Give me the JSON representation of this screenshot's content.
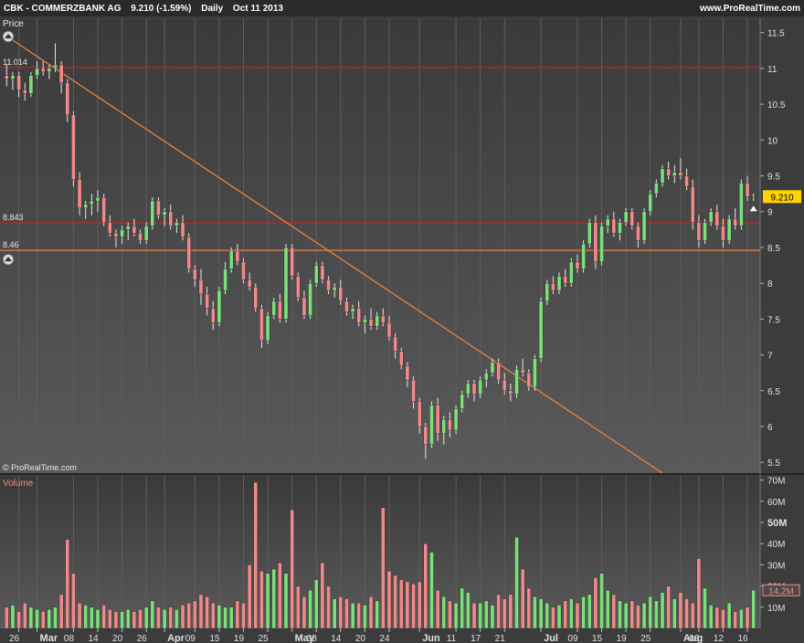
{
  "header": {
    "symbol": "CBK - COMMERZBANK AG",
    "quote": "9.210 (-1.59%)",
    "period": "Daily",
    "date": "Oct 11 2013",
    "site": "www.ProRealTime.com"
  },
  "panels": {
    "price_label": "Price",
    "volume_label": "Volume",
    "copyright": "© ProRealTime.com",
    "last_price_tag": "9.210",
    "last_volume_tag": "14.2M"
  },
  "colors": {
    "up": "#7be07b",
    "down": "#f08a8a",
    "resistance": "#cc2222",
    "support": "#e8804a",
    "trendline": "#e8804a",
    "price_tag": "#ffd400"
  },
  "chart_data": [
    {
      "type": "candlestick",
      "title": "CBK - COMMERZBANK AG",
      "ylabel": "Price",
      "ylim": [
        5.35,
        11.7
      ],
      "y_ticks": [
        5.5,
        6,
        6.5,
        7,
        7.5,
        8,
        8.5,
        9,
        9.5,
        10,
        10.5,
        11,
        11.5
      ],
      "x_ticks": [
        {
          "i": 2,
          "label": "26",
          "bold": false
        },
        {
          "i": 5,
          "label": "Mar",
          "bold": true
        },
        {
          "i": 11,
          "label": "08",
          "bold": false
        },
        {
          "i": 15,
          "label": "14",
          "bold": false
        },
        {
          "i": 19,
          "label": "20",
          "bold": false
        },
        {
          "i": 23,
          "label": "26",
          "bold": false
        },
        {
          "i": 26,
          "label": "Apr",
          "bold": true
        },
        {
          "i": 31,
          "label": "09",
          "bold": false
        },
        {
          "i": 35,
          "label": "15",
          "bold": false
        },
        {
          "i": 39,
          "label": "19",
          "bold": false
        },
        {
          "i": 43,
          "label": "25",
          "bold": false
        },
        {
          "i": 47,
          "label": "May",
          "bold": true
        },
        {
          "i": 51,
          "label": "08",
          "bold": false
        },
        {
          "i": 55,
          "label": "14",
          "bold": false
        },
        {
          "i": 59,
          "label": "20",
          "bold": false
        },
        {
          "i": 63,
          "label": "24",
          "bold": false
        },
        {
          "i": 68,
          "label": "Jun",
          "bold": true
        },
        {
          "i": 74,
          "label": "11",
          "bold": false
        },
        {
          "i": 78,
          "label": "17",
          "bold": false
        },
        {
          "i": 82,
          "label": "21",
          "bold": false
        },
        {
          "i": 88,
          "label": "Jul",
          "bold": true
        },
        {
          "i": 94,
          "label": "09",
          "bold": false
        },
        {
          "i": 98,
          "label": "15",
          "bold": false
        },
        {
          "i": 102,
          "label": "19",
          "bold": false
        },
        {
          "i": 106,
          "label": "25",
          "bold": false
        },
        {
          "i": 111,
          "label": "Aug",
          "bold": true
        },
        {
          "i": 114,
          "label": "06",
          "bold": false
        },
        {
          "i": 118,
          "label": "12",
          "bold": false
        },
        {
          "i": 122,
          "label": "16",
          "bold": false
        }
      ],
      "x_count": 124,
      "horizontal_lines": [
        {
          "value": 11.014,
          "label": "11.014",
          "color_key": "resistance"
        },
        {
          "value": 8.843,
          "label": "8.843",
          "color_key": "resistance"
        },
        {
          "value": 8.46,
          "label": "8.46",
          "color_key": "support"
        }
      ],
      "trendline": {
        "from": {
          "i": 0,
          "price": 11.45
        },
        "to": {
          "i": 108,
          "price": 5.35
        }
      },
      "ohlc": [
        [
          10.9,
          11.05,
          10.75,
          10.85
        ],
        [
          10.85,
          10.95,
          10.7,
          10.9
        ],
        [
          10.9,
          10.95,
          10.6,
          10.7
        ],
        [
          10.7,
          10.8,
          10.55,
          10.65
        ],
        [
          10.65,
          10.95,
          10.6,
          10.9
        ],
        [
          10.9,
          11.1,
          10.85,
          11.0
        ],
        [
          11.0,
          11.1,
          10.9,
          10.95
        ],
        [
          10.95,
          11.05,
          10.85,
          11.0
        ],
        [
          11.0,
          11.35,
          10.95,
          11.05
        ],
        [
          11.05,
          11.1,
          10.65,
          10.8
        ],
        [
          10.8,
          10.85,
          10.25,
          10.35
        ],
        [
          10.35,
          10.4,
          9.35,
          9.45
        ],
        [
          9.45,
          9.55,
          8.95,
          9.05
        ],
        [
          9.05,
          9.15,
          8.9,
          9.1
        ],
        [
          9.1,
          9.25,
          8.95,
          9.15
        ],
        [
          9.15,
          9.3,
          9.0,
          9.2
        ],
        [
          9.2,
          9.25,
          8.8,
          8.85
        ],
        [
          8.85,
          8.95,
          8.65,
          8.7
        ],
        [
          8.7,
          8.75,
          8.5,
          8.65
        ],
        [
          8.65,
          8.8,
          8.55,
          8.75
        ],
        [
          8.75,
          8.85,
          8.6,
          8.8
        ],
        [
          8.8,
          8.9,
          8.65,
          8.7
        ],
        [
          8.7,
          8.75,
          8.55,
          8.6
        ],
        [
          8.6,
          8.85,
          8.55,
          8.8
        ],
        [
          8.8,
          9.2,
          8.75,
          9.15
        ],
        [
          9.15,
          9.2,
          8.9,
          8.95
        ],
        [
          8.95,
          9.05,
          8.8,
          9.0
        ],
        [
          9.0,
          9.1,
          8.75,
          8.8
        ],
        [
          8.8,
          8.9,
          8.7,
          8.85
        ],
        [
          8.85,
          8.95,
          8.6,
          8.65
        ],
        [
          8.65,
          8.7,
          8.15,
          8.2
        ],
        [
          8.2,
          8.25,
          7.95,
          8.05
        ],
        [
          8.05,
          8.2,
          7.7,
          7.85
        ],
        [
          7.85,
          7.95,
          7.55,
          7.65
        ],
        [
          7.65,
          7.75,
          7.35,
          7.45
        ],
        [
          7.45,
          7.95,
          7.4,
          7.9
        ],
        [
          7.9,
          8.3,
          7.85,
          8.2
        ],
        [
          8.2,
          8.5,
          8.15,
          8.45
        ],
        [
          8.45,
          8.55,
          8.25,
          8.3
        ],
        [
          8.3,
          8.35,
          8.0,
          8.05
        ],
        [
          8.05,
          8.15,
          7.9,
          7.95
        ],
        [
          7.95,
          8.0,
          7.6,
          7.65
        ],
        [
          7.65,
          7.7,
          7.1,
          7.2
        ],
        [
          7.2,
          7.6,
          7.15,
          7.55
        ],
        [
          7.55,
          7.8,
          7.5,
          7.75
        ],
        [
          7.75,
          7.85,
          7.45,
          7.5
        ],
        [
          7.5,
          8.55,
          7.45,
          8.5
        ],
        [
          8.5,
          8.55,
          8.05,
          8.1
        ],
        [
          8.1,
          8.15,
          7.75,
          7.8
        ],
        [
          7.8,
          7.9,
          7.5,
          7.55
        ],
        [
          7.55,
          8.05,
          7.5,
          8.0
        ],
        [
          8.0,
          8.3,
          7.95,
          8.25
        ],
        [
          8.25,
          8.3,
          8.0,
          8.05
        ],
        [
          8.05,
          8.1,
          7.85,
          7.9
        ],
        [
          7.9,
          8.0,
          7.8,
          7.95
        ],
        [
          7.95,
          8.05,
          7.7,
          7.75
        ],
        [
          7.75,
          7.8,
          7.55,
          7.6
        ],
        [
          7.6,
          7.7,
          7.5,
          7.65
        ],
        [
          7.65,
          7.75,
          7.4,
          7.45
        ],
        [
          7.45,
          7.55,
          7.3,
          7.5
        ],
        [
          7.5,
          7.65,
          7.35,
          7.4
        ],
        [
          7.4,
          7.6,
          7.35,
          7.55
        ],
        [
          7.55,
          7.65,
          7.4,
          7.45
        ],
        [
          7.45,
          7.55,
          7.2,
          7.25
        ],
        [
          7.25,
          7.3,
          6.95,
          7.05
        ],
        [
          7.05,
          7.1,
          6.8,
          6.85
        ],
        [
          6.85,
          6.9,
          6.55,
          6.65
        ],
        [
          6.65,
          6.7,
          6.25,
          6.35
        ],
        [
          6.35,
          6.4,
          5.9,
          6.0
        ],
        [
          6.0,
          6.05,
          5.55,
          5.75
        ],
        [
          5.75,
          6.35,
          5.7,
          6.3
        ],
        [
          6.3,
          6.4,
          5.8,
          5.9
        ],
        [
          5.9,
          6.15,
          5.75,
          6.1
        ],
        [
          6.1,
          6.2,
          5.85,
          5.95
        ],
        [
          5.95,
          6.3,
          5.9,
          6.25
        ],
        [
          6.25,
          6.5,
          6.2,
          6.45
        ],
        [
          6.45,
          6.65,
          6.4,
          6.6
        ],
        [
          6.6,
          6.65,
          6.35,
          6.45
        ],
        [
          6.45,
          6.7,
          6.4,
          6.65
        ],
        [
          6.65,
          6.8,
          6.55,
          6.75
        ],
        [
          6.75,
          6.95,
          6.7,
          6.9
        ],
        [
          6.9,
          6.95,
          6.6,
          6.65
        ],
        [
          6.65,
          6.75,
          6.45,
          6.5
        ],
        [
          6.5,
          6.6,
          6.35,
          6.45
        ],
        [
          6.45,
          6.85,
          6.4,
          6.8
        ],
        [
          6.8,
          6.95,
          6.7,
          6.75
        ],
        [
          6.75,
          6.8,
          6.5,
          6.55
        ],
        [
          6.55,
          7.0,
          6.5,
          6.95
        ],
        [
          6.95,
          7.8,
          6.9,
          7.75
        ],
        [
          7.75,
          8.05,
          7.7,
          8.0
        ],
        [
          8.0,
          8.1,
          7.85,
          7.9
        ],
        [
          7.9,
          8.15,
          7.85,
          8.1
        ],
        [
          8.1,
          8.2,
          7.95,
          8.0
        ],
        [
          8.0,
          8.35,
          7.95,
          8.3
        ],
        [
          8.3,
          8.4,
          8.15,
          8.2
        ],
        [
          8.2,
          8.6,
          8.15,
          8.55
        ],
        [
          8.55,
          8.9,
          8.5,
          8.85
        ],
        [
          8.85,
          8.95,
          8.2,
          8.3
        ],
        [
          8.3,
          8.85,
          8.25,
          8.8
        ],
        [
          8.8,
          8.95,
          8.7,
          8.9
        ],
        [
          8.9,
          9.0,
          8.65,
          8.7
        ],
        [
          8.7,
          8.9,
          8.6,
          8.85
        ],
        [
          8.85,
          9.05,
          8.8,
          9.0
        ],
        [
          9.0,
          9.05,
          8.75,
          8.8
        ],
        [
          8.8,
          8.85,
          8.5,
          8.6
        ],
        [
          8.6,
          9.05,
          8.55,
          9.0
        ],
        [
          9.0,
          9.3,
          8.95,
          9.25
        ],
        [
          9.25,
          9.45,
          9.2,
          9.4
        ],
        [
          9.4,
          9.65,
          9.35,
          9.6
        ],
        [
          9.6,
          9.7,
          9.45,
          9.5
        ],
        [
          9.5,
          9.65,
          9.4,
          9.55
        ],
        [
          9.55,
          9.75,
          9.45,
          9.5
        ],
        [
          9.5,
          9.6,
          9.3,
          9.35
        ],
        [
          9.35,
          9.45,
          8.75,
          8.85
        ],
        [
          8.85,
          8.95,
          8.5,
          8.6
        ],
        [
          8.6,
          8.9,
          8.55,
          8.85
        ],
        [
          8.85,
          9.05,
          8.8,
          9.0
        ],
        [
          9.0,
          9.1,
          8.75,
          8.8
        ],
        [
          8.8,
          8.9,
          8.5,
          8.6
        ],
        [
          8.6,
          8.95,
          8.55,
          8.9
        ],
        [
          8.9,
          9.05,
          8.75,
          8.8
        ],
        [
          8.8,
          9.45,
          8.75,
          9.4
        ],
        [
          9.4,
          9.5,
          9.15,
          9.21
        ],
        [
          9.21,
          9.25,
          9.15,
          9.21
        ]
      ]
    },
    {
      "type": "bar",
      "title": "Volume",
      "ylabel": "Volume",
      "ylim": [
        0,
        72
      ],
      "y_ticks": [
        {
          "v": 10,
          "label": "10M",
          "bold": false
        },
        {
          "v": 20,
          "label": "20M",
          "bold": false
        },
        {
          "v": 30,
          "label": "30M",
          "bold": false
        },
        {
          "v": 40,
          "label": "40M",
          "bold": false
        },
        {
          "v": 50,
          "label": "50M",
          "bold": true
        },
        {
          "v": 60,
          "label": "60M",
          "bold": false
        },
        {
          "v": 70,
          "label": "70M",
          "bold": false
        }
      ],
      "unit": "M",
      "values": [
        10,
        11,
        8,
        12,
        10,
        9,
        8,
        9,
        10,
        16,
        42,
        26,
        12,
        11,
        10,
        9,
        11,
        9,
        8,
        8,
        9,
        8,
        9,
        10,
        13,
        10,
        9,
        10,
        9,
        11,
        12,
        13,
        16,
        15,
        12,
        11,
        10,
        10,
        13,
        12,
        30,
        69,
        27,
        26,
        28,
        31,
        26,
        56,
        20,
        15,
        18,
        23,
        31,
        20,
        14,
        15,
        14,
        12,
        12,
        11,
        15,
        13,
        57,
        27,
        25,
        23,
        22,
        21,
        22,
        40,
        36,
        18,
        15,
        13,
        12,
        19,
        17,
        12,
        12,
        13,
        11,
        16,
        14,
        16,
        43,
        28,
        19,
        15,
        14,
        12,
        10,
        11,
        13,
        14,
        12,
        15,
        16,
        24,
        26,
        18,
        16,
        13,
        12,
        13,
        11,
        12,
        15,
        13,
        17,
        20,
        14,
        17,
        14,
        12,
        33,
        19,
        11,
        10,
        9,
        12,
        8,
        9,
        10,
        18
      ]
    }
  ]
}
